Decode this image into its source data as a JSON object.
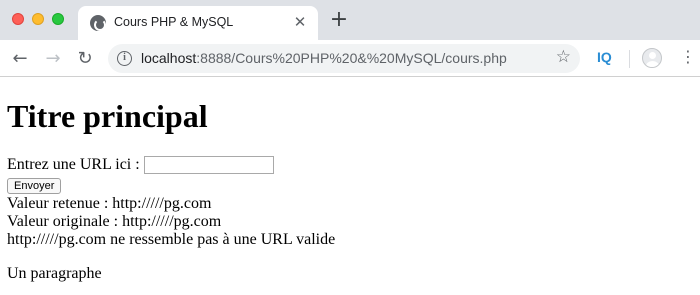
{
  "browser": {
    "tab": {
      "title": "Cours PHP & MySQL",
      "close_glyph": "✕",
      "favicon": "site-favicon"
    },
    "new_tab_glyph": "+",
    "nav": {
      "back_glyph": "←",
      "forward_glyph": "→",
      "reload_glyph": "↻"
    },
    "address": {
      "host": "localhost",
      "rest": ":8888/Cours%20PHP%20&%20MySQL/cours.php",
      "info_glyph": "i",
      "star_glyph": "☆"
    },
    "extension_label": "IQ",
    "menu_glyph": "⋮"
  },
  "page": {
    "heading": "Titre principal",
    "form": {
      "label": "Entrez une URL ici : ",
      "input_value": "",
      "submit_label": "Envoyer"
    },
    "lines": {
      "retained": "Valeur retenue : http://///pg.com",
      "original": "Valeur originale : http://///pg.com",
      "invalid": "http://///pg.com ne ressemble pas à une URL valide"
    },
    "paragraph": "Un paragraphe"
  },
  "colors": {
    "tabbar_bg": "#dee1e6",
    "close_red": "#fe5f57",
    "minimize_yellow": "#febc2e",
    "zoom_green": "#28c840",
    "extension_blue": "#2a8dd4"
  }
}
